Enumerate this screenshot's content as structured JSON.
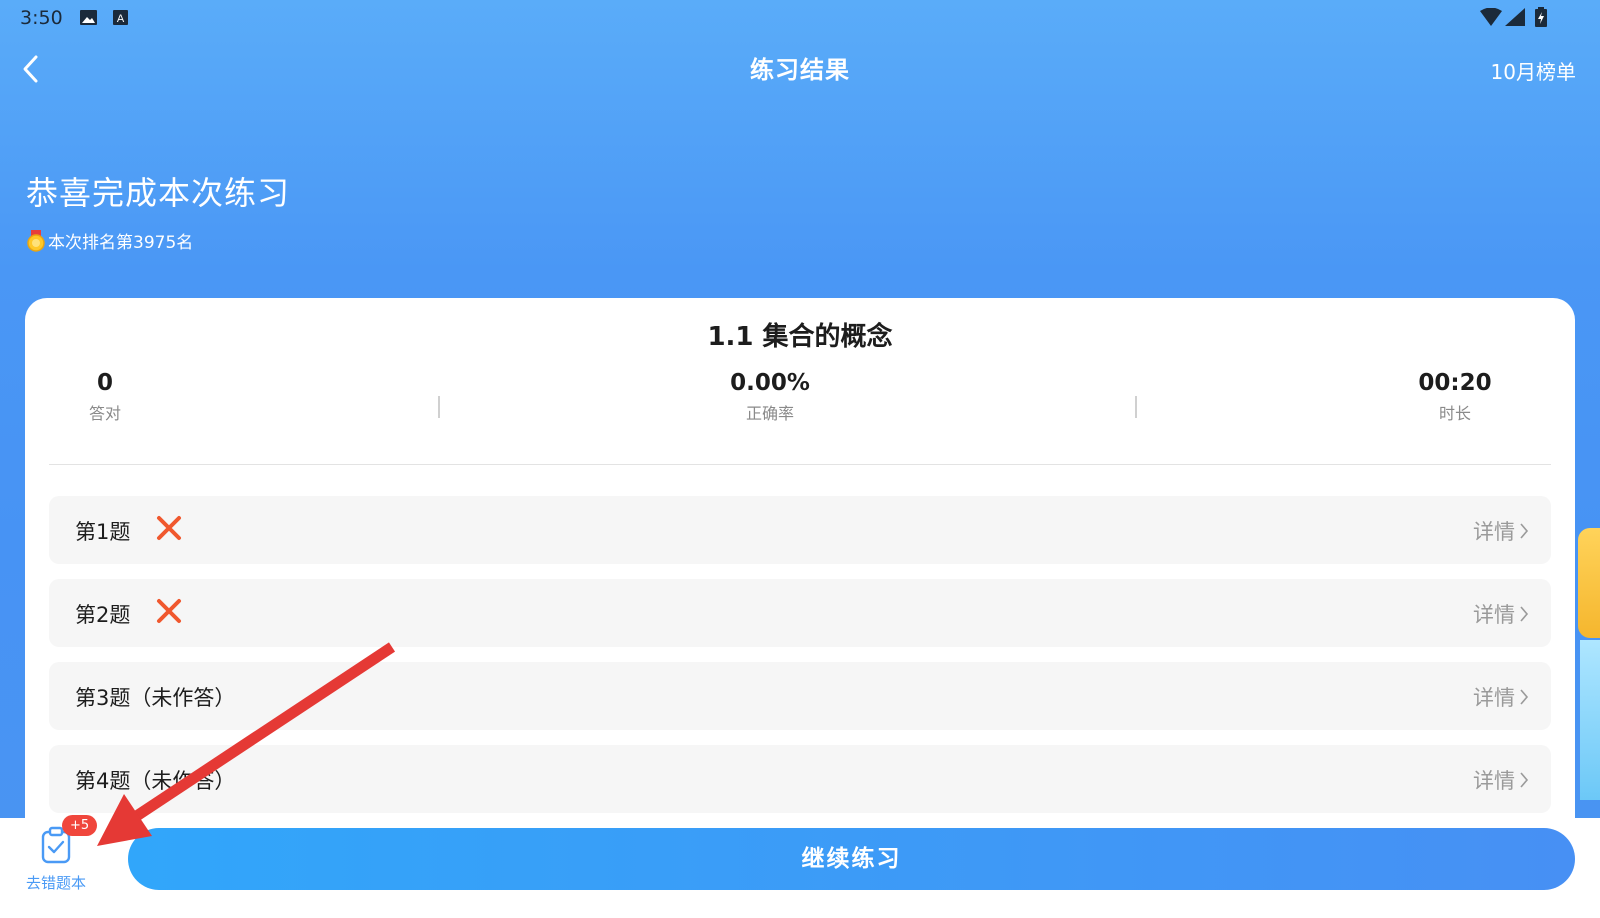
{
  "status_bar": {
    "time": "3:50",
    "icons": [
      "image-icon",
      "a-box-icon",
      "wifi-icon",
      "signal-icon",
      "battery-icon"
    ]
  },
  "nav": {
    "title": "练习结果",
    "right_link": "10月榜单"
  },
  "header": {
    "congrats": "恭喜完成本次练习",
    "rank": "本次排名第3975名"
  },
  "card": {
    "title": "1.1 集合的概念",
    "stats": [
      {
        "value": "0",
        "label": "答对"
      },
      {
        "value": "0.00%",
        "label": "正确率"
      },
      {
        "value": "00:20",
        "label": "时长"
      }
    ],
    "questions": [
      {
        "label": "第1题",
        "status": "wrong",
        "detail": "详情"
      },
      {
        "label": "第2题",
        "status": "wrong",
        "detail": "详情"
      },
      {
        "label": "第3题（未作答）",
        "status": "unanswered",
        "detail": "详情"
      },
      {
        "label": "第4题（未作答）",
        "status": "unanswered",
        "detail": "详情"
      }
    ]
  },
  "bottom": {
    "wrong_book_label": "去错题本",
    "badge": "+5",
    "continue_label": "继续练习"
  },
  "colors": {
    "primary": "#4a97f5",
    "wrong": "#f0582e",
    "badge": "#f0463c",
    "annotation_arrow": "#e53935"
  }
}
